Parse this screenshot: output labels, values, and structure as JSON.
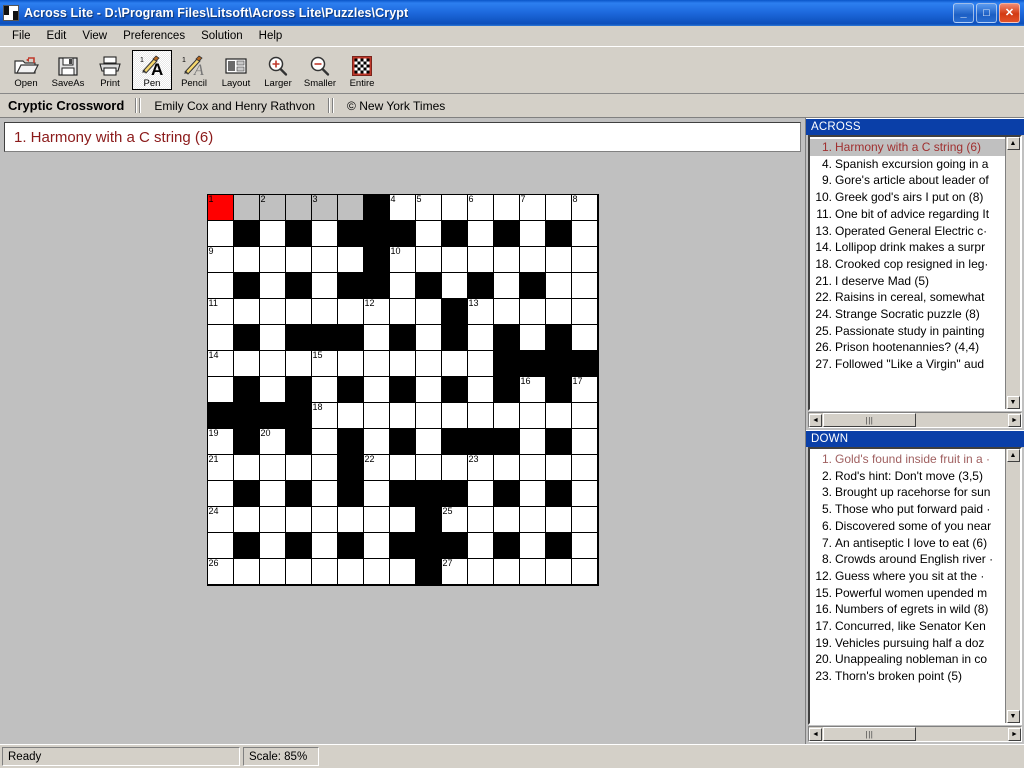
{
  "window": {
    "title": "Across Lite  -  D:\\Program Files\\Litsoft\\Across Lite\\Puzzles\\Crypt",
    "app_icon": "grid-icon",
    "minimize_label": "_",
    "maximize_label": "□",
    "close_label": "✕"
  },
  "menubar": {
    "items": [
      {
        "label": "File"
      },
      {
        "label": "Edit"
      },
      {
        "label": "View"
      },
      {
        "label": "Preferences"
      },
      {
        "label": "Solution"
      },
      {
        "label": "Help"
      }
    ]
  },
  "toolbar": {
    "buttons": [
      {
        "label": "Open",
        "icon": "open-folder-icon",
        "active": false
      },
      {
        "label": "SaveAs",
        "icon": "floppy-disk-icon",
        "active": false
      },
      {
        "label": "Print",
        "icon": "printer-icon",
        "active": false
      },
      {
        "label": "Pen",
        "icon": "pen-icon",
        "active": true
      },
      {
        "label": "Pencil",
        "icon": "pencil-icon",
        "active": false
      },
      {
        "label": "Layout",
        "icon": "layout-icon",
        "active": false
      },
      {
        "label": "Larger",
        "icon": "zoom-in-icon",
        "active": false
      },
      {
        "label": "Smaller",
        "icon": "zoom-out-icon",
        "active": false
      },
      {
        "label": "Entire",
        "icon": "entire-grid-icon",
        "active": false
      }
    ]
  },
  "puzzle_info": {
    "title": "Cryptic Crossword",
    "author": "Emily Cox and Henry Rathvon",
    "copyright": "© New York Times"
  },
  "current_clue": {
    "text": "1. Harmony with a C string (6)",
    "color": "#8b1a1a"
  },
  "across": {
    "header": "ACROSS",
    "clues": [
      {
        "num": "1.",
        "text": "Harmony with a C string (6)",
        "selected": true
      },
      {
        "num": "4.",
        "text": "Spanish excursion going in a",
        "selected": false
      },
      {
        "num": "9.",
        "text": "Gore's article about leader of",
        "selected": false
      },
      {
        "num": "10.",
        "text": "Greek god's airs I put on (8)",
        "selected": false
      },
      {
        "num": "11.",
        "text": "One bit of advice regarding It",
        "selected": false
      },
      {
        "num": "13.",
        "text": "Operated General Electric c·",
        "selected": false
      },
      {
        "num": "14.",
        "text": "Lollipop drink makes a surpr",
        "selected": false
      },
      {
        "num": "18.",
        "text": "Crooked cop resigned in leg·",
        "selected": false
      },
      {
        "num": "21.",
        "text": "I deserve Mad (5)",
        "selected": false
      },
      {
        "num": "22.",
        "text": "Raisins in cereal, somewhat",
        "selected": false
      },
      {
        "num": "24.",
        "text": "Strange Socratic puzzle (8)",
        "selected": false
      },
      {
        "num": "25.",
        "text": "Passionate study in painting",
        "selected": false
      },
      {
        "num": "26.",
        "text": "Prison hootenannies? (4,4)",
        "selected": false
      },
      {
        "num": "27.",
        "text": "Followed \"Like a Virgin\" aud",
        "selected": false
      }
    ]
  },
  "down": {
    "header": "DOWN",
    "clues": [
      {
        "num": "1.",
        "text": "Gold's found inside fruit in a ·",
        "selected": true
      },
      {
        "num": "2.",
        "text": "Rod's hint: Don't move (3,5)",
        "selected": false
      },
      {
        "num": "3.",
        "text": "Brought up racehorse for sun",
        "selected": false
      },
      {
        "num": "5.",
        "text": "Those who put forward paid ·",
        "selected": false
      },
      {
        "num": "6.",
        "text": "Discovered some of you near",
        "selected": false
      },
      {
        "num": "7.",
        "text": "An antiseptic I love to eat (6)",
        "selected": false
      },
      {
        "num": "8.",
        "text": "Crowds around English river ·",
        "selected": false
      },
      {
        "num": "12.",
        "text": "Guess where you sit at the ·",
        "selected": false
      },
      {
        "num": "15.",
        "text": "Powerful women upended m",
        "selected": false
      },
      {
        "num": "16.",
        "text": "Numbers of egrets in wild (8)",
        "selected": false
      },
      {
        "num": "17.",
        "text": "Concurred, like Senator Ken",
        "selected": false
      },
      {
        "num": "19.",
        "text": "Vehicles pursuing half a doz",
        "selected": false
      },
      {
        "num": "20.",
        "text": "Unappealing nobleman in co",
        "selected": false
      },
      {
        "num": "23.",
        "text": "Thorn's broken point (5)",
        "selected": false
      }
    ]
  },
  "scrollbars": {
    "up_arrow": "▲",
    "down_arrow": "▼",
    "left_arrow": "◄",
    "right_arrow": "►",
    "thumb_grip": "|||"
  },
  "statusbar": {
    "ready": "Ready",
    "scale": "Scale: 85%"
  },
  "grid": {
    "rows": 15,
    "cols": 15,
    "cursor_cell": [
      0,
      0
    ],
    "highlight_color": "#c0c0c0",
    "cursor_color": "#ff0000",
    "layout": [
      "...........B....",
      "WWWWWWBWWWWWWWW",
      "WBWBWBBBWBWBWBW",
      "WWWWWWBWWWWWWWW",
      "WBWBWBBWBWBWBWW",
      "WWWWWWWWWBWWWWW",
      "WBWBBBWBWBWBWBW",
      "WWWWWWWWWWWBBBB",
      "WBWBWBWBWBWBWBW",
      "BBBBWWWWWWWWWWW",
      "WBWBWBWBWBBBWBW",
      "WWWWWBWWWWWWWWW",
      "WBWBWBWBBBWBWBW",
      "WWWWWWWWBWWWWWW",
      "WBWBWBWBBBWBWBW",
      "WWWWWWWWBWWWWWW"
    ],
    "cells": [
      [
        "C",
        "H",
        "H",
        "H",
        "H",
        "H",
        "B",
        "W",
        "W",
        "W",
        "W",
        "W",
        "W",
        "W",
        "W"
      ],
      [
        "W",
        "B",
        "W",
        "B",
        "W",
        "B",
        "B",
        "B",
        "W",
        "B",
        "W",
        "B",
        "W",
        "B",
        "W"
      ],
      [
        "W",
        "W",
        "W",
        "W",
        "W",
        "W",
        "B",
        "W",
        "W",
        "W",
        "W",
        "W",
        "W",
        "W",
        "W"
      ],
      [
        "W",
        "B",
        "W",
        "B",
        "W",
        "B",
        "B",
        "W",
        "B",
        "W",
        "B",
        "W",
        "B",
        "W",
        "W"
      ],
      [
        "W",
        "W",
        "W",
        "W",
        "W",
        "W",
        "W",
        "W",
        "W",
        "B",
        "W",
        "W",
        "W",
        "W",
        "W"
      ],
      [
        "W",
        "B",
        "W",
        "B",
        "B",
        "B",
        "W",
        "B",
        "W",
        "B",
        "W",
        "B",
        "W",
        "B",
        "W"
      ],
      [
        "W",
        "W",
        "W",
        "W",
        "W",
        "W",
        "W",
        "W",
        "W",
        "W",
        "W",
        "B",
        "B",
        "B",
        "B"
      ],
      [
        "W",
        "B",
        "W",
        "B",
        "W",
        "B",
        "W",
        "B",
        "W",
        "B",
        "W",
        "B",
        "W",
        "B",
        "W"
      ],
      [
        "B",
        "B",
        "B",
        "B",
        "W",
        "W",
        "W",
        "W",
        "W",
        "W",
        "W",
        "W",
        "W",
        "W",
        "W"
      ],
      [
        "W",
        "B",
        "W",
        "B",
        "W",
        "B",
        "W",
        "B",
        "W",
        "B",
        "B",
        "B",
        "W",
        "B",
        "W"
      ],
      [
        "W",
        "W",
        "W",
        "W",
        "W",
        "B",
        "W",
        "W",
        "W",
        "W",
        "W",
        "W",
        "W",
        "W",
        "W"
      ],
      [
        "W",
        "B",
        "W",
        "B",
        "W",
        "B",
        "W",
        "B",
        "B",
        "B",
        "W",
        "B",
        "W",
        "B",
        "W"
      ],
      [
        "W",
        "W",
        "W",
        "W",
        "W",
        "W",
        "W",
        "W",
        "B",
        "W",
        "W",
        "W",
        "W",
        "W",
        "W"
      ],
      [
        "W",
        "B",
        "W",
        "B",
        "W",
        "B",
        "W",
        "B",
        "B",
        "B",
        "W",
        "B",
        "W",
        "B",
        "W"
      ],
      [
        "W",
        "W",
        "W",
        "W",
        "W",
        "W",
        "W",
        "W",
        "B",
        "W",
        "W",
        "W",
        "W",
        "W",
        "W"
      ]
    ],
    "numbers": [
      {
        "r": 0,
        "c": 0,
        "n": "1"
      },
      {
        "r": 0,
        "c": 2,
        "n": "2"
      },
      {
        "r": 0,
        "c": 4,
        "n": "3"
      },
      {
        "r": 0,
        "c": 7,
        "n": "4"
      },
      {
        "r": 0,
        "c": 8,
        "n": "5"
      },
      {
        "r": 0,
        "c": 10,
        "n": "6"
      },
      {
        "r": 0,
        "c": 12,
        "n": "7"
      },
      {
        "r": 0,
        "c": 14,
        "n": "8"
      },
      {
        "r": 2,
        "c": 0,
        "n": "9"
      },
      {
        "r": 2,
        "c": 7,
        "n": "10"
      },
      {
        "r": 4,
        "c": 0,
        "n": "11"
      },
      {
        "r": 4,
        "c": 6,
        "n": "12"
      },
      {
        "r": 4,
        "c": 10,
        "n": "13"
      },
      {
        "r": 6,
        "c": 0,
        "n": "14"
      },
      {
        "r": 6,
        "c": 4,
        "n": "15"
      },
      {
        "r": 7,
        "c": 12,
        "n": "16"
      },
      {
        "r": 7,
        "c": 14,
        "n": "17"
      },
      {
        "r": 8,
        "c": 4,
        "n": "18"
      },
      {
        "r": 9,
        "c": 0,
        "n": "19"
      },
      {
        "r": 9,
        "c": 2,
        "n": "20"
      },
      {
        "r": 10,
        "c": 0,
        "n": "21"
      },
      {
        "r": 10,
        "c": 6,
        "n": "22"
      },
      {
        "r": 10,
        "c": 10,
        "n": "23"
      },
      {
        "r": 12,
        "c": 0,
        "n": "24"
      },
      {
        "r": 12,
        "c": 9,
        "n": "25"
      },
      {
        "r": 14,
        "c": 0,
        "n": "26"
      },
      {
        "r": 14,
        "c": 9,
        "n": "27"
      }
    ]
  }
}
